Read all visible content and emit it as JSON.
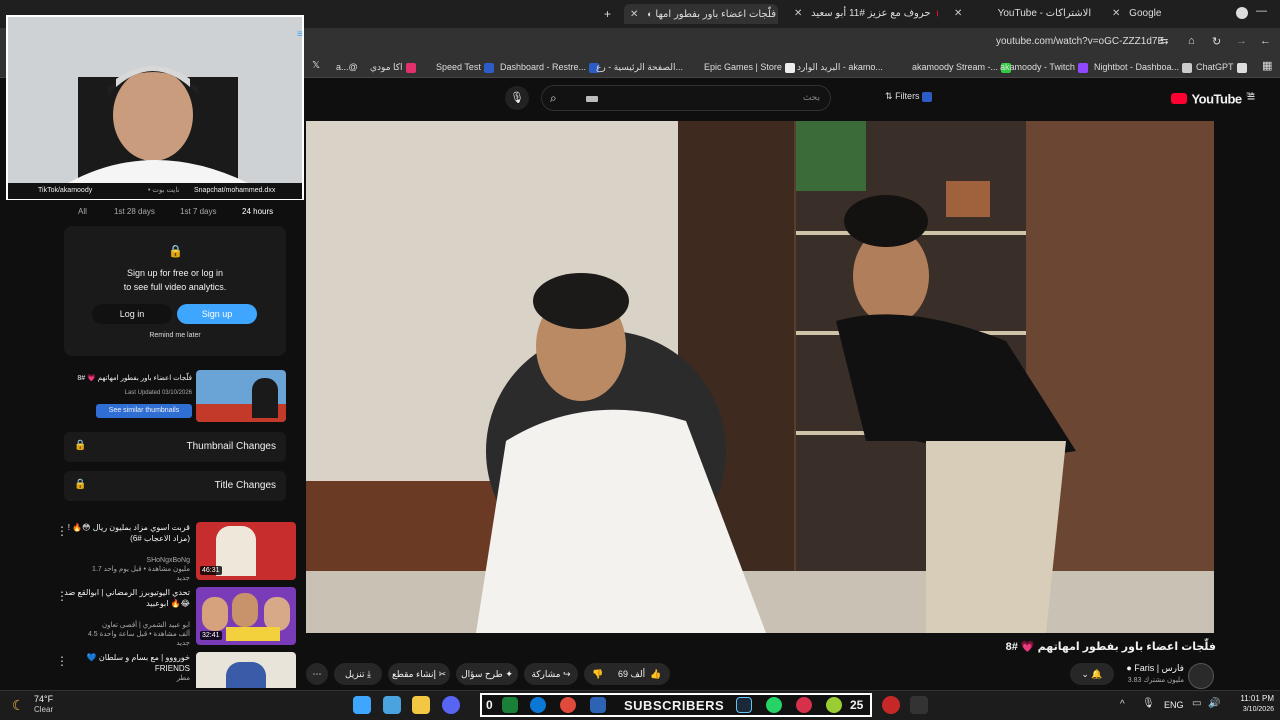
{
  "tabs": [
    {
      "label": "Google"
    },
    {
      "label": "YouTube - الاشتراكات"
    },
    {
      "label": "حروف مع عزيز #11 أبو سعيد"
    },
    {
      "label": "فلّجات اعضاء باور بفطور امها"
    }
  ],
  "address": {
    "url": "youtube.com/watch?v=oGC-ZZZ1d7E"
  },
  "bookmarks": [
    {
      "label": "ChatGPT"
    },
    {
      "label": "Nightbot - Dashboa..."
    },
    {
      "label": "akamoody - Twitch"
    },
    {
      "label": "akamoody Stream -..."
    },
    {
      "label": "البريد الوارد - akamo..."
    },
    {
      "label": "Epic Games | Store"
    },
    {
      "label": "الصفحة الرئيسية - رع..."
    },
    {
      "label": "Dashboard - Restre..."
    },
    {
      "label": "Speed Test"
    },
    {
      "label": "اكا مودي"
    },
    {
      "label": "a...@"
    }
  ],
  "yt": {
    "logo": "YouTube",
    "region": "SA",
    "search_placeholder": "بحث",
    "filters": "Filters"
  },
  "webcam": {
    "left_tag": "TikTok/akamoody",
    "mid_tag": "• نايت بوت",
    "right_tag": "Snapchat/mohammed.dxx"
  },
  "analytics": {
    "chips": [
      "All",
      "1st 28 days",
      "1st 7 days",
      "24 hours"
    ],
    "prompt_line1": "Sign up for free or log in",
    "prompt_line2": "to see full video analytics.",
    "login": "Log in",
    "signup": "Sign up",
    "remind": "Remind me later",
    "card_title": "فلّجات اعضاء باور بفطور امهاتهم 💗 #8",
    "card_updated": "Last Updated 03/10/2026",
    "similar": "See similar thumbnails",
    "thumb_changes": "Thumbnail Changes",
    "title_changes": "Title Changes"
  },
  "recommendations": [
    {
      "title": "قربت اسوي مزاد بمليون ريال 😳🔥 ! (مزاد الاعجاب #6)",
      "channel": "SHoNgxBoNg",
      "meta": "1.7 مليون مشاهدة • قبل يوم واحد",
      "duration": "46:31",
      "badge": "جديد"
    },
    {
      "title": "تحدي اليوتيوبرز الرمضاني | ابوالقع ضد ابوعبيد 🔥😂",
      "channel": "ابو عبيد الشمري | أقصى تعاون",
      "meta": "4.5 ألف مشاهدة • قبل ساعة واحدة",
      "duration": "32:41",
      "badge": "جديد"
    },
    {
      "title": "💙 خورووو | مع بسام و سلطان FRIENDS",
      "channel": "مطر",
      "meta": "",
      "duration": "",
      "badge": ""
    }
  ],
  "video_info": {
    "title": "فلّجات اعضاء باور بفطور امهاتهم 💗 #8",
    "channel": "Faris | فارس",
    "subs": "3.83 مليون مشترك",
    "likes": "69 ألف",
    "share": "مشاركة",
    "ask": "طرح سؤال",
    "clip": "إنشاء مقطع",
    "download": "تنزيل"
  },
  "taskbar": {
    "weather_temp": "74°F",
    "weather_desc": "Clear",
    "overlay_count": "0",
    "overlay_label": "SUBSCRIBERS",
    "overlay_subs": "25",
    "lang": "ENG",
    "time": "11:01 PM",
    "date": "3/10/2026"
  },
  "colors": {
    "brand": "#ff0033",
    "accent": "#3ea6ff",
    "bg": "#0f0f0f"
  }
}
